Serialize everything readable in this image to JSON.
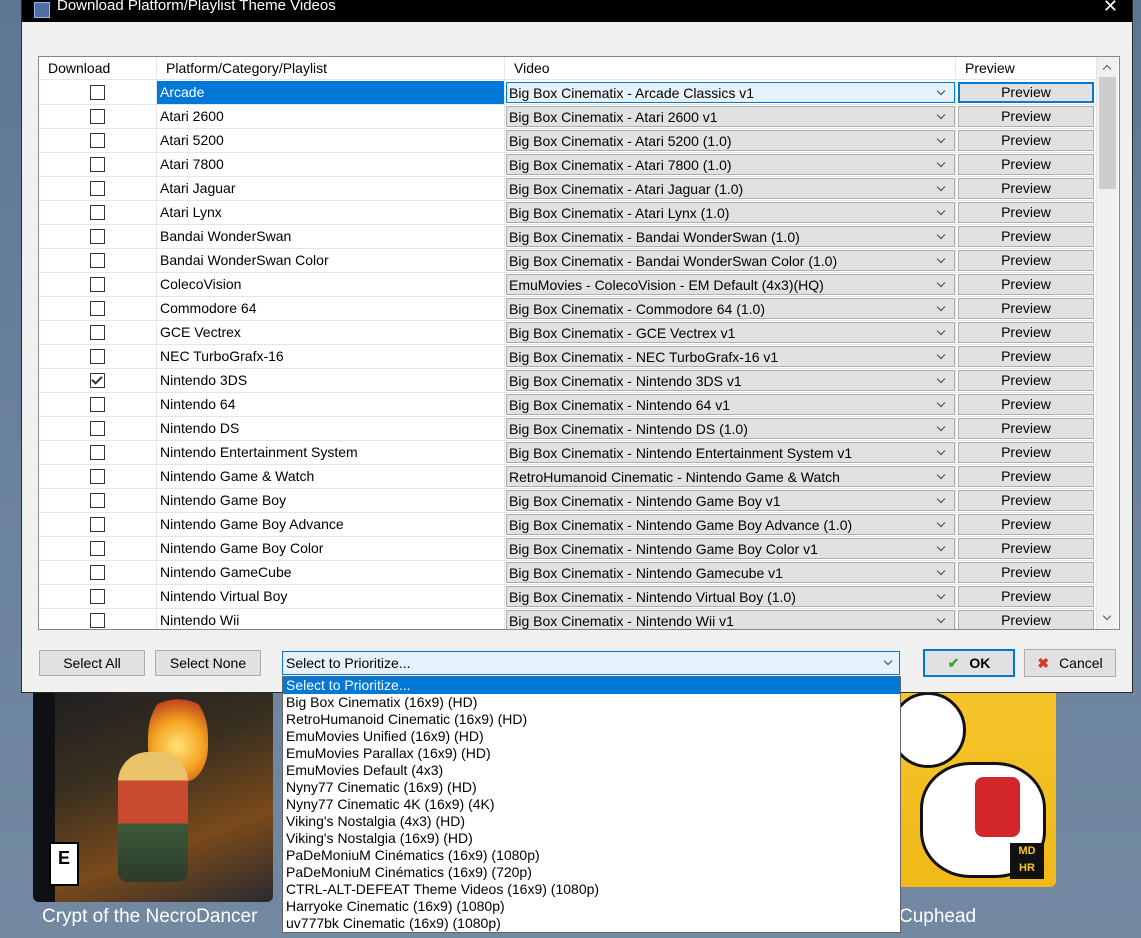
{
  "window": {
    "title": "Download Platform/Playlist Theme Videos",
    "close_glyph": "✕"
  },
  "grid": {
    "headers": {
      "download": "Download",
      "platform": "Platform/Category/Playlist",
      "video": "Video",
      "preview": "Preview"
    },
    "preview_label": "Preview",
    "rows": [
      {
        "checked": false,
        "platform": "Arcade",
        "video": "Big Box Cinematix - Arcade Classics v1",
        "selected": true
      },
      {
        "checked": false,
        "platform": "Atari 2600",
        "video": "Big Box Cinematix - Atari 2600 v1"
      },
      {
        "checked": false,
        "platform": "Atari 5200",
        "video": "Big Box Cinematix - Atari 5200 (1.0)"
      },
      {
        "checked": false,
        "platform": "Atari 7800",
        "video": "Big Box Cinematix - Atari 7800 (1.0)"
      },
      {
        "checked": false,
        "platform": "Atari Jaguar",
        "video": "Big Box Cinematix - Atari Jaguar (1.0)"
      },
      {
        "checked": false,
        "platform": "Atari Lynx",
        "video": "Big Box Cinematix - Atari Lynx (1.0)"
      },
      {
        "checked": false,
        "platform": "Bandai WonderSwan",
        "video": "Big Box Cinematix - Bandai WonderSwan (1.0)"
      },
      {
        "checked": false,
        "platform": "Bandai WonderSwan Color",
        "video": "Big Box Cinematix - Bandai WonderSwan Color (1.0)"
      },
      {
        "checked": false,
        "platform": "ColecoVision",
        "video": "EmuMovies - ColecoVision - EM Default (4x3)(HQ)"
      },
      {
        "checked": false,
        "platform": "Commodore 64",
        "video": "Big Box Cinematix - Commodore 64 (1.0)"
      },
      {
        "checked": false,
        "platform": "GCE Vectrex",
        "video": "Big Box Cinematix - GCE Vectrex v1"
      },
      {
        "checked": false,
        "platform": "NEC TurboGrafx-16",
        "video": "Big Box Cinematix - NEC TurboGrafx-16 v1"
      },
      {
        "checked": true,
        "platform": "Nintendo 3DS",
        "video": "Big Box Cinematix - Nintendo 3DS v1"
      },
      {
        "checked": false,
        "platform": "Nintendo 64",
        "video": "Big Box Cinematix - Nintendo 64 v1"
      },
      {
        "checked": false,
        "platform": "Nintendo DS",
        "video": "Big Box Cinematix - Nintendo DS (1.0)"
      },
      {
        "checked": false,
        "platform": "Nintendo Entertainment System",
        "video": "Big Box Cinematix - Nintendo Entertainment System v1"
      },
      {
        "checked": false,
        "platform": "Nintendo Game & Watch",
        "video": "RetroHumanoid Cinematic - Nintendo Game & Watch"
      },
      {
        "checked": false,
        "platform": "Nintendo Game Boy",
        "video": "Big Box Cinematix - Nintendo Game Boy v1"
      },
      {
        "checked": false,
        "platform": "Nintendo Game Boy Advance",
        "video": "Big Box Cinematix - Nintendo Game Boy Advance (1.0)"
      },
      {
        "checked": false,
        "platform": "Nintendo Game Boy Color",
        "video": "Big Box Cinematix - Nintendo Game Boy Color v1"
      },
      {
        "checked": false,
        "platform": "Nintendo GameCube",
        "video": "Big Box Cinematix - Nintendo Gamecube v1"
      },
      {
        "checked": false,
        "platform": "Nintendo Virtual Boy",
        "video": "Big Box Cinematix - Nintendo Virtual Boy (1.0)"
      },
      {
        "checked": false,
        "platform": "Nintendo Wii",
        "video": "Big Box Cinematix - Nintendo Wii v1"
      }
    ]
  },
  "buttons": {
    "select_all": "Select All",
    "select_none": "Select None",
    "ok": "OK",
    "cancel": "Cancel"
  },
  "prioritize": {
    "value": "Select to Prioritize...",
    "options": [
      "Select to Prioritize...",
      "Big Box Cinematix (16x9) (HD)",
      "RetroHumanoid Cinematic (16x9) (HD)",
      "EmuMovies Unified (16x9) (HD)",
      "EmuMovies Parallax (16x9) (HD)",
      "EmuMovies Default (4x3)",
      "Nyny77 Cinematic (16x9) (HD)",
      "Nyny77 Cinematic 4K (16x9) (4K)",
      "Viking's Nostalgia (4x3) (HD)",
      "Viking's Nostalgia (16x9) (HD)",
      "PaDeMoniuM Cinématics (16x9) (1080p)",
      "PaDeMoniuM Cinématics (16x9) (720p)",
      "CTRL-ALT-DEFEAT Theme Videos (16x9) (1080p)",
      "Harryoke Cinematic (16x9) (1080p)",
      "uv777bk Cinematic (16x9) (1080p)"
    ]
  },
  "background": {
    "left_title": "Crypt of the NecroDancer",
    "right_title": "Cuphead",
    "left_rating": "E",
    "right_logo": "MD HR"
  },
  "colors": {
    "accent": "#0078d7",
    "window_bg": "#f0f0f0",
    "titlebar": "#000000"
  },
  "icons": {
    "ok": "check-icon",
    "cancel": "x-icon",
    "window": "app-icon"
  }
}
